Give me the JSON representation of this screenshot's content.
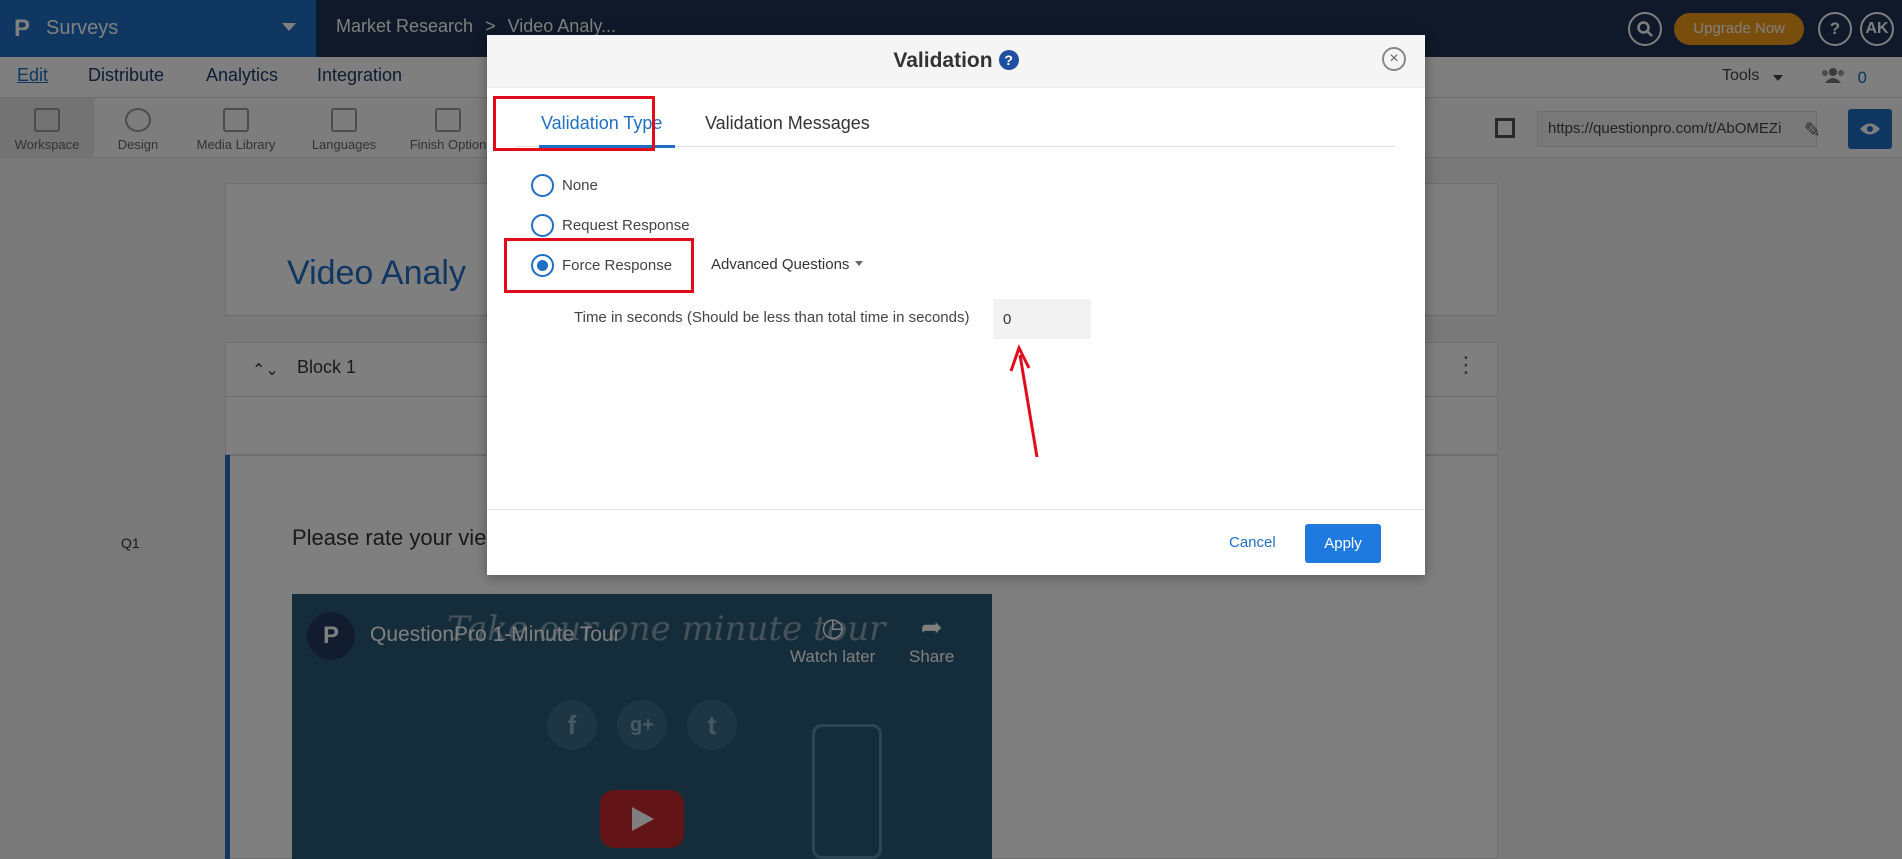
{
  "topbar": {
    "logo": "P",
    "app_name": "Surveys",
    "breadcrumb": [
      "Market Research",
      ">",
      "Video Analy..."
    ],
    "upgrade_label": "Upgrade Now",
    "help_label": "?",
    "user_initials": "AK"
  },
  "menu": {
    "items": [
      "Edit",
      "Distribute",
      "Analytics",
      "Integration"
    ],
    "tools_label": "Tools",
    "collaborators_count": "0"
  },
  "toolbar": {
    "items": [
      "Workspace",
      "Design",
      "Media Library",
      "Languages",
      "Finish Option"
    ],
    "survey_url": "https://questionpro.com/t/AbOMEZi"
  },
  "page": {
    "survey_title": "Video Analy",
    "block_label": "Block 1",
    "question_number": "Q1",
    "question_text": "Please rate your vie",
    "video": {
      "channel_logo": "P",
      "title": "QuestionPro 1-Minute Tour",
      "overlay_text": "Take our one minute tour",
      "watch_later": "Watch later",
      "share": "Share",
      "social": [
        "f",
        "g+",
        "t"
      ]
    }
  },
  "modal": {
    "title": "Validation",
    "help_icon": "?",
    "close_icon": "×",
    "tabs": [
      "Validation Type",
      "Validation Messages"
    ],
    "options": [
      {
        "label": "None",
        "checked": false
      },
      {
        "label": "Request Response",
        "checked": false
      },
      {
        "label": "Force Response",
        "checked": true
      }
    ],
    "advanced_label": "Advanced Questions",
    "time_label": "Time in seconds (Should be less than total time in seconds)",
    "time_value": "0",
    "cancel_label": "Cancel",
    "apply_label": "Apply"
  },
  "colors": {
    "brand_blue": "#1f6fc5",
    "header_navy": "#1f3353",
    "upgrade_orange": "#f29d1a",
    "highlight_red": "#e10b1b"
  }
}
